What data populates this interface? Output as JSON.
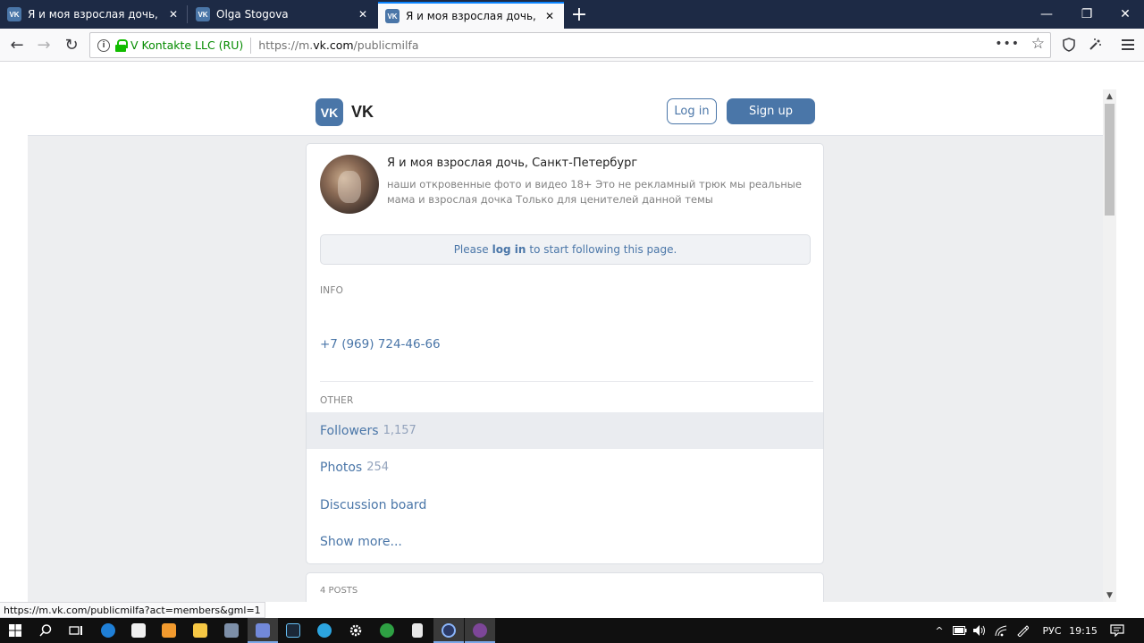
{
  "browser": {
    "tabs": [
      {
        "title": "Я и моя взрослая дочь, Санкт-Петербург",
        "favicon": "vk-icon"
      },
      {
        "title": "Olga Stogova",
        "favicon": "vk-icon"
      },
      {
        "title": "Я и моя взрослая дочь, Санкт-Петербург",
        "favicon": "vk-icon"
      }
    ],
    "favicon_text": "VK",
    "new_tab": "+",
    "window_controls": {
      "minimize": "—",
      "restore": "❐",
      "close": "✕"
    },
    "nav": {
      "back": "←",
      "forward": "→",
      "reload": "↻"
    },
    "urlbar": {
      "info": "i",
      "org": "V Kontakte LLC (RU)",
      "url_prefix": "https://m.",
      "url_domain": "vk.com",
      "url_path": "/publicmilfa",
      "more": "•••",
      "bookmark": "☆"
    },
    "toolbar_icons": [
      "shield-icon",
      "extensions-icon",
      "menu-icon"
    ],
    "status_url": "https://m.vk.com/publicmilfa?act=members&gml=1"
  },
  "vk": {
    "logo_text": "VK",
    "name": "VK",
    "login_label": "Log in",
    "signup_label": "Sign up",
    "group": {
      "name": "Я и моя взрослая дочь, Санкт-Петербург",
      "description": "наши откровенные фото и видео 18+ Это не рекламный трюк мы реальные мама и взрослая дочка Только для ценителей данной темы"
    },
    "notice": {
      "before": "Please",
      "link": "log in",
      "after": "to start following this page."
    },
    "info_label": "INFO",
    "phone": "+7 (969) 724-46-66",
    "other_label": "OTHER",
    "other": [
      {
        "label": "Followers",
        "count": "1,157"
      },
      {
        "label": "Photos",
        "count": "254"
      },
      {
        "label": "Discussion board",
        "count": ""
      },
      {
        "label": "Show more...",
        "count": ""
      }
    ],
    "posts_label": "4 POSTS"
  },
  "taskbar": {
    "language": "РУС",
    "time": "19:15",
    "apps": [
      "windows-start-icon",
      "search-icon",
      "task-view-icon",
      "edge-icon",
      "store-icon",
      "app-orange-icon",
      "file-explorer-icon",
      "app-photos-icon",
      "discord-icon",
      "steam-icon",
      "telegram-icon",
      "settings-icon",
      "app-green-icon",
      "calculator-icon",
      "firefox-icon",
      "tor-browser-icon"
    ],
    "colors": {
      "accent": "#4a76a8",
      "taskbar": "#101010"
    }
  }
}
